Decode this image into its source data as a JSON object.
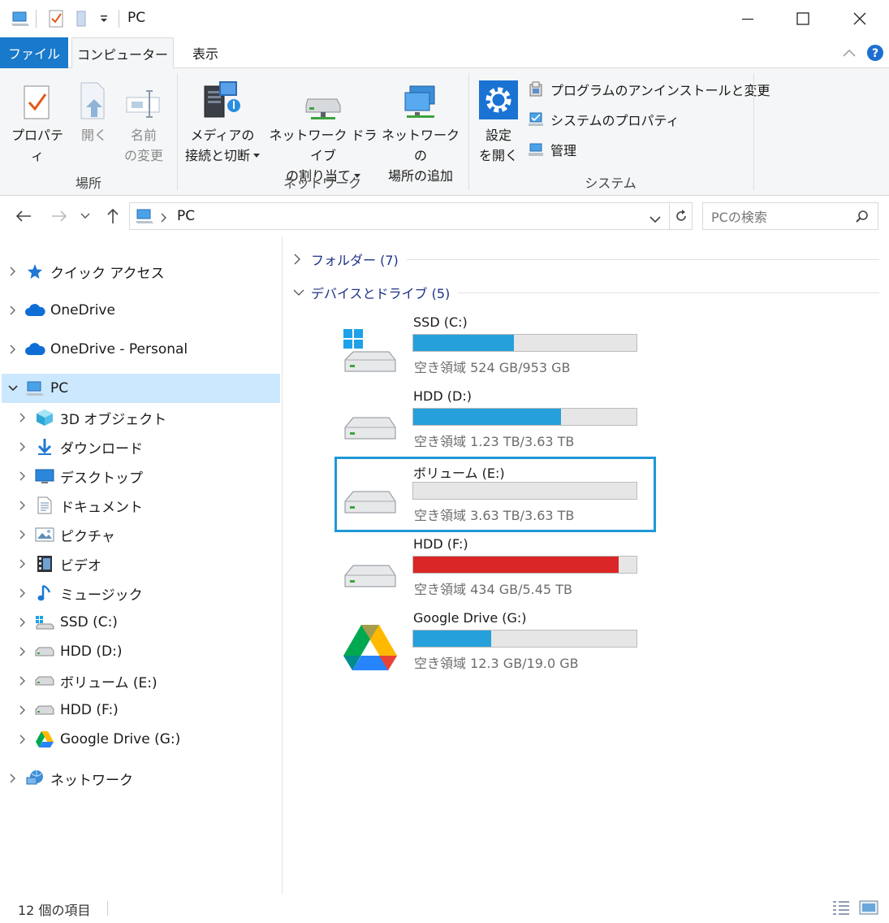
{
  "window": {
    "title": "PC"
  },
  "tabs": {
    "file": "ファイル",
    "computer": "コンピューター",
    "view": "表示"
  },
  "ribbon": {
    "location": {
      "properties": "プロパティ",
      "open": "開く",
      "rename_line1": "名前",
      "rename_line2": "の変更",
      "group": "場所"
    },
    "network": {
      "media_line1": "メディアの",
      "media_line2": "接続と切断",
      "map_line1": "ネットワーク ドライブ",
      "map_line2": "の割り当て",
      "add_line1": "ネットワークの",
      "add_line2": "場所の追加",
      "group": "ネットワーク"
    },
    "system": {
      "settings_line1": "設定",
      "settings_line2": "を開く",
      "uninstall": "プログラムのアンインストールと変更",
      "sysprops": "システムのプロパティ",
      "manage": "管理",
      "group": "システム"
    }
  },
  "address": {
    "path": "PC",
    "search_placeholder": "PCの検索"
  },
  "nav": {
    "quick": "クイック アクセス",
    "onedrive": "OneDrive",
    "onedrive_personal": "OneDrive - Personal",
    "pc": "PC",
    "children": [
      {
        "label": "3D オブジェクト",
        "icon": "3d-objects-icon"
      },
      {
        "label": "ダウンロード",
        "icon": "download-icon"
      },
      {
        "label": "デスクトップ",
        "icon": "desktop-icon"
      },
      {
        "label": "ドキュメント",
        "icon": "document-icon"
      },
      {
        "label": "ピクチャ",
        "icon": "picture-icon"
      },
      {
        "label": "ビデオ",
        "icon": "video-icon"
      },
      {
        "label": "ミュージック",
        "icon": "music-icon"
      },
      {
        "label": "SSD (C:)",
        "icon": "ssd-drive-icon"
      },
      {
        "label": "HDD (D:)",
        "icon": "hdd-drive-icon"
      },
      {
        "label": "ボリューム (E:)",
        "icon": "hdd-drive-icon"
      },
      {
        "label": "HDD (F:)",
        "icon": "hdd-drive-icon"
      },
      {
        "label": "Google Drive (G:)",
        "icon": "google-drive-icon"
      }
    ],
    "network": "ネットワーク"
  },
  "content": {
    "folders_header": "フォルダー (7)",
    "devices_header": "デバイスとドライブ (5)",
    "drives": [
      {
        "name": "SSD (C:)",
        "free": "空き領域 524 GB/953 GB",
        "used_fraction": 0.45,
        "bar_color": "#26a0da",
        "icon": "windows-drive-icon"
      },
      {
        "name": "HDD (D:)",
        "free": "空き領域 1.23 TB/3.63 TB",
        "used_fraction": 0.66,
        "bar_color": "#26a0da",
        "icon": "hdd-icon"
      },
      {
        "name": "ボリューム (E:)",
        "free": "空き領域 3.63 TB/3.63 TB",
        "used_fraction": 0.0,
        "bar_color": "#26a0da",
        "icon": "hdd-icon"
      },
      {
        "name": "HDD (F:)",
        "free": "空き領域 434 GB/5.45 TB",
        "used_fraction": 0.92,
        "bar_color": "#da2626",
        "icon": "hdd-icon"
      },
      {
        "name": "Google Drive (G:)",
        "free": "空き領域 12.3 GB/19.0 GB",
        "used_fraction": 0.35,
        "bar_color": "#26a0da",
        "icon": "google-drive-icon"
      }
    ]
  },
  "status": {
    "count": "12 個の項目"
  },
  "colors": {
    "accent": "#1979ca",
    "selection": "#cce8ff",
    "highlight_box": "#1e98d7",
    "bar_normal": "#26a0da",
    "bar_full": "#da2626"
  }
}
